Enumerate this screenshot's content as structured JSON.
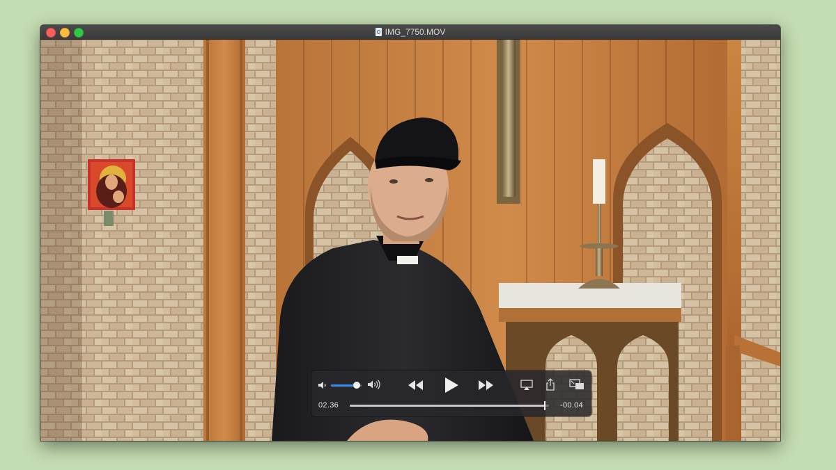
{
  "window": {
    "title": "IMG_7750.MOV",
    "file_icon": "quicktime-file-icon"
  },
  "player": {
    "elapsed": "02.36",
    "remaining": "-00.04",
    "progress_fraction": 0.98,
    "volume_fraction": 0.85
  },
  "controls": {
    "mute": "speaker-low-icon",
    "volume_max": "speaker-high-icon",
    "rewind": "rewind-icon",
    "play": "play-icon",
    "fast_forward": "fast-forward-icon",
    "airplay": "airplay-icon",
    "share": "share-icon",
    "picture_in_picture": "picture-in-picture-icon"
  },
  "colors": {
    "desktop_bg": "#c4dcb1",
    "volume_accent": "#3a8ff0",
    "close": "#fc605c",
    "minimize": "#fdbc40",
    "maximize": "#34c749"
  }
}
